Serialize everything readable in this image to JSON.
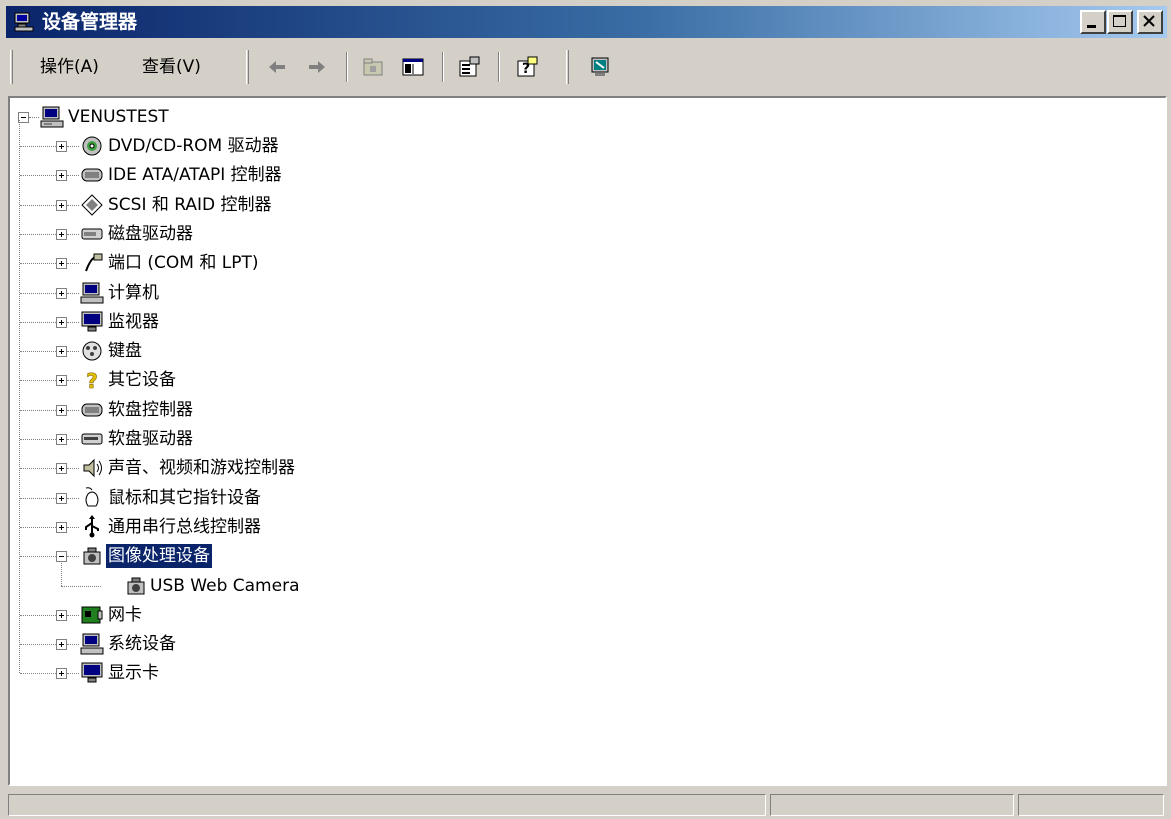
{
  "window": {
    "title": "设备管理器"
  },
  "toolbar": {
    "menu_action": "操作(A)",
    "menu_view": "查看(V)",
    "buttons": [
      "back-arrow-icon",
      "forward-arrow-icon",
      "up-folder-icon",
      "show-hide-tree-icon",
      "properties-icon",
      "help-icon",
      "scan-hardware-icon"
    ]
  },
  "tree": {
    "root": "VENUSTEST",
    "items": [
      {
        "label": "DVD/CD-ROM 驱动器",
        "icon": "cdrom-icon",
        "expanded": false
      },
      {
        "label": "IDE ATA/ATAPI 控制器",
        "icon": "ide-controller-icon",
        "expanded": false
      },
      {
        "label": "SCSI 和 RAID 控制器",
        "icon": "scsi-icon",
        "expanded": false
      },
      {
        "label": "磁盘驱动器",
        "icon": "disk-drive-icon",
        "expanded": false
      },
      {
        "label": "端口 (COM 和 LPT)",
        "icon": "port-icon",
        "expanded": false
      },
      {
        "label": "计算机",
        "icon": "computer-icon",
        "expanded": false
      },
      {
        "label": "监视器",
        "icon": "monitor-icon",
        "expanded": false
      },
      {
        "label": "键盘",
        "icon": "keyboard-icon",
        "expanded": false
      },
      {
        "label": "其它设备",
        "icon": "question-mark-icon",
        "expanded": false
      },
      {
        "label": "软盘控制器",
        "icon": "floppy-controller-icon",
        "expanded": false
      },
      {
        "label": "软盘驱动器",
        "icon": "floppy-drive-icon",
        "expanded": false
      },
      {
        "label": "声音、视频和游戏控制器",
        "icon": "speaker-icon",
        "expanded": false
      },
      {
        "label": "鼠标和其它指针设备",
        "icon": "mouse-icon",
        "expanded": false
      },
      {
        "label": "通用串行总线控制器",
        "icon": "usb-icon",
        "expanded": false
      },
      {
        "label": "图像处理设备",
        "icon": "camera-icon",
        "expanded": true,
        "selected": true,
        "children": [
          {
            "label": "USB Web Camera",
            "icon": "webcam-icon"
          }
        ]
      },
      {
        "label": "网卡",
        "icon": "network-card-icon",
        "expanded": false
      },
      {
        "label": "系统设备",
        "icon": "system-device-icon",
        "expanded": false
      },
      {
        "label": "显示卡",
        "icon": "display-adapter-icon",
        "expanded": false
      }
    ]
  },
  "status": {
    "panes": [
      "",
      "",
      ""
    ]
  },
  "colors": {
    "title_start": "#0a246a",
    "title_end": "#a6caf0",
    "face": "#d4d0c8",
    "selection": "#0a246a"
  }
}
